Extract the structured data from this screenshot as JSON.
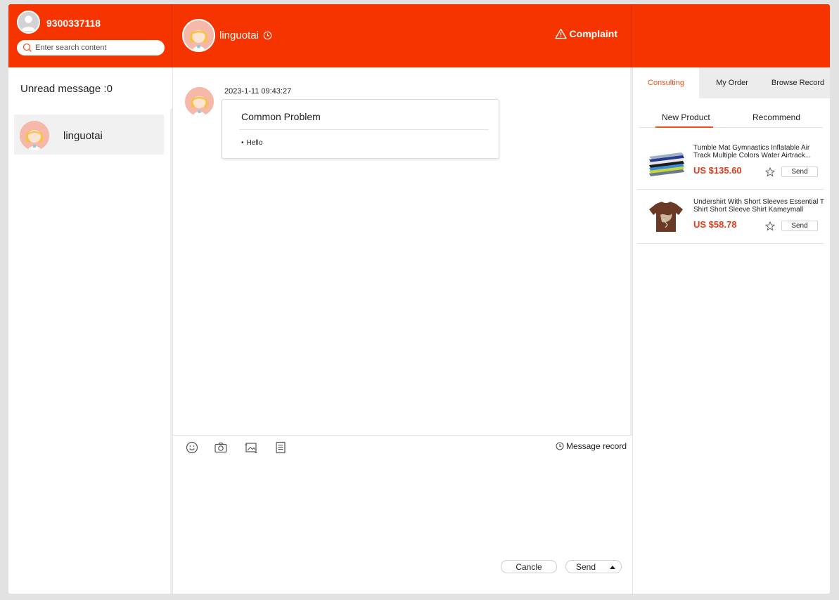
{
  "user": {
    "id": "9300337118"
  },
  "search": {
    "placeholder": "Enter search content"
  },
  "header": {
    "peer_name": "linguotai",
    "complaint_label": "Complaint"
  },
  "sidebar": {
    "unread_label": "Unread message :0",
    "conversations": [
      {
        "name": "linguotai"
      }
    ]
  },
  "chat": {
    "messages": [
      {
        "time": "2023-1-11 09:43:27",
        "card_title": "Common Problem",
        "items": [
          "Hello"
        ]
      }
    ]
  },
  "compose": {
    "message_record_label": "Message record",
    "cancel_label": "Cancle",
    "send_label": "Send",
    "tools": [
      "smiley-icon",
      "camera-icon",
      "image-icon",
      "document-icon"
    ]
  },
  "right_panel": {
    "tabs": [
      "Consulting",
      "My Order",
      "Browse Record"
    ],
    "active_tab": "Consulting",
    "subtabs": [
      "New Product",
      "Recommend"
    ],
    "active_subtab": "New Product",
    "products": [
      {
        "title": "Tumble Mat Gymnastics Inflatable Air Track Multiple Colors Water Airtrack...",
        "price": "US $135.60",
        "send_label": "Send"
      },
      {
        "title": "Undershirt With Short Sleeves Essential T Shirt Short Sleeve Shirt Kameymall",
        "price": "US $58.78",
        "send_label": "Send"
      }
    ]
  },
  "colors": {
    "brand": "#f53400",
    "accent": "#f24e1e",
    "price": "#e23c1e"
  }
}
